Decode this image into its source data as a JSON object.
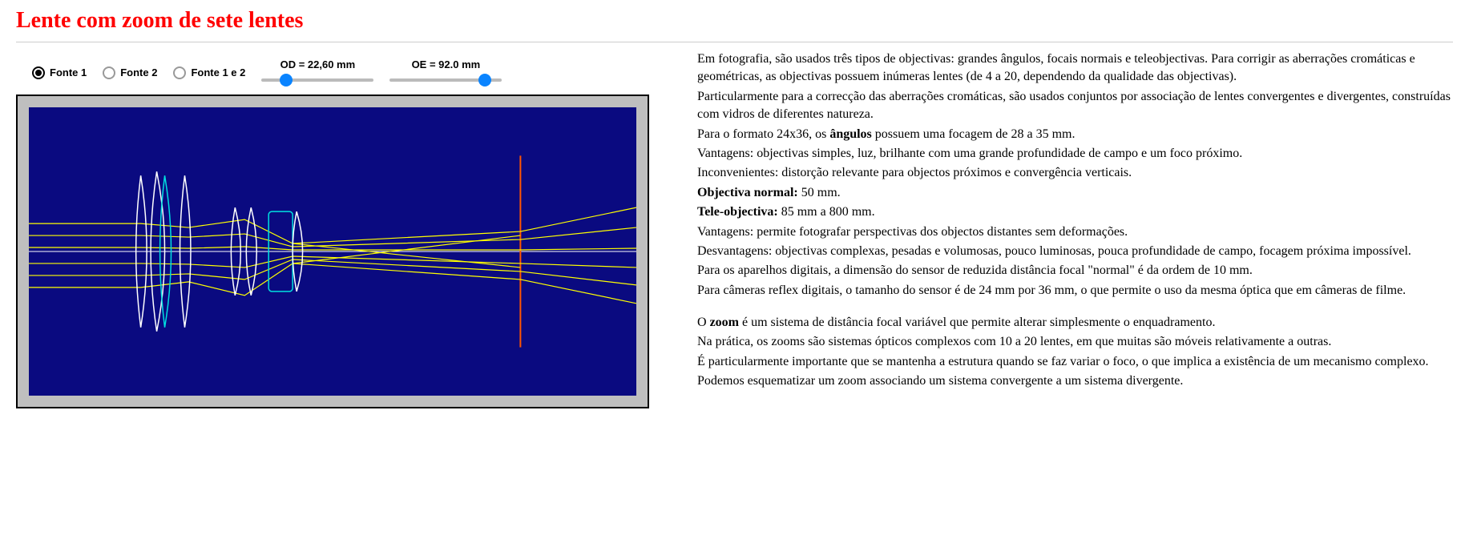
{
  "title": "Lente com zoom de sete lentes",
  "radios": {
    "r1": "Fonte 1",
    "r2": "Fonte 2",
    "r3": "Fonte 1 e 2"
  },
  "sliders": {
    "od_label": "OD = 22,60 mm",
    "oe_label": "OE = 92.0 mm"
  },
  "text": {
    "p1": "Em fotografia, são usados três tipos de objectivas: grandes ângulos, focais normais e teleobjectivas. Para corrigir as aberrações cromáticas e geométricas, as objectivas possuem inúmeras lentes (de 4 a 20, dependendo da qualidade das objectivas).",
    "p2": "Particularmente para a correcção das aberrações cromáticas, são usados conjuntos por associação de lentes convergentes e divergentes, construídas com vidros de diferentes natureza.",
    "p3a": "Para o formato 24x36, os ",
    "p3b": "ângulos",
    "p3c": " possuem uma focagem de 28 a 35 mm.",
    "p4": "Vantagens: objectivas simples, luz, brilhante com uma grande profundidade de campo e um foco próximo.",
    "p5": "Inconvenientes: distorção relevante para objectos próximos e convergência verticais.",
    "p6a": "Objectiva normal:",
    "p6b": " 50 mm.",
    "p7a": "Tele-objectiva:",
    "p7b": " 85 mm a 800 mm.",
    "p8": "Vantagens: permite fotografar perspectivas dos objectos distantes sem deformações.",
    "p9": "Desvantagens: objectivas complexas, pesadas e volumosas, pouco luminosas, pouca profundidade de campo, focagem próxima impossível.",
    "p10": "Para os aparelhos digitais, a dimensão do sensor de reduzida distância focal \"normal\" é da ordem de 10 mm.",
    "p11": "Para câmeras reflex digitais, o tamanho do sensor é de 24 mm por 36 mm, o que permite o uso da mesma óptica que em câmeras de filme.",
    "p12a": "O ",
    "p12b": "zoom",
    "p12c": " é um sistema de distância focal variável que permite alterar simplesmente o enquadramento.",
    "p13": "Na prática, os zooms são sistemas ópticos complexos com 10 a 20 lentes, em que muitas são móveis relativamente a outras.",
    "p14": "É particularmente importante que se mantenha a estrutura quando se faz variar o foco, o que implica a existência de um mecanismo complexo.",
    "p15": "Podemos esquematizar um zoom associando um sistema convergente a um sistema divergente."
  }
}
